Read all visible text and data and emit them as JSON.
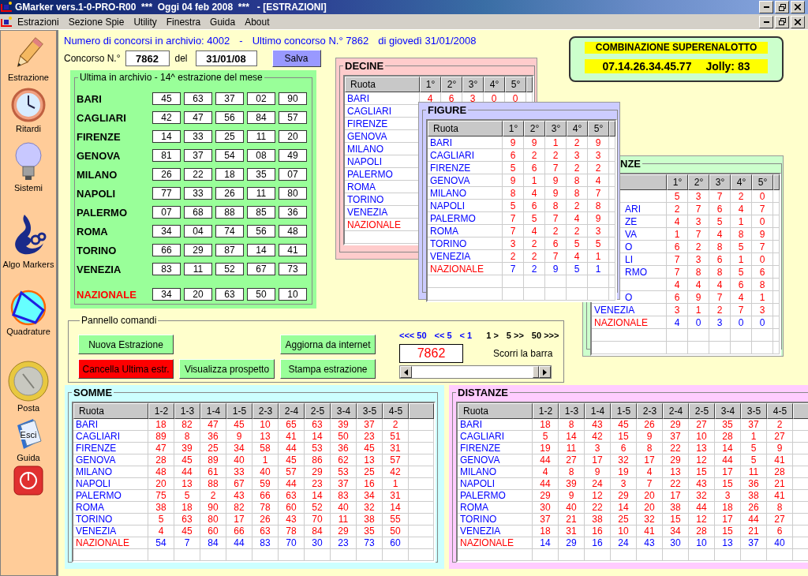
{
  "window": {
    "title": "GMarker vers.1-0-PRO-R00  ***  Oggi 04 feb 2008  ***   - [ESTRAZIONI]"
  },
  "menu": [
    "Estrazioni",
    "Sezione Spie",
    "Utility",
    "Finestra",
    "Guida",
    "About"
  ],
  "sidebar": [
    {
      "kind": "pencil",
      "label": "Estrazione"
    },
    {
      "kind": "clock",
      "label": "Ritardi"
    },
    {
      "kind": "bulb",
      "label": "Sistemi"
    },
    {
      "kind": "logo",
      "label": "Algo Markers"
    },
    {
      "kind": "shape",
      "label": "Quadrature"
    },
    {
      "kind": "coin",
      "label": "Posta"
    },
    {
      "kind": "book",
      "label": "Guida",
      "overlay": "Esci"
    },
    {
      "kind": "power"
    }
  ],
  "header": {
    "archive": "Numero di concorsi in archivio: 4002",
    "separator": "-",
    "last": "Ultimo concorso N.° 7862",
    "date": "di giovedì 31/01/2008"
  },
  "concorso": {
    "label": "Concorso N.°",
    "number": "7862",
    "del": "del",
    "date": "31/01/08",
    "save": "Salva"
  },
  "ultima": {
    "title": "Ultima in archivio - 14^ estrazione del mese",
    "rows": [
      {
        "name": "BARI",
        "kind": "ruota",
        "numbers": [
          "45",
          "63",
          "37",
          "02",
          "90"
        ]
      },
      {
        "name": "CAGLIARI",
        "kind": "ruota",
        "numbers": [
          "42",
          "47",
          "56",
          "84",
          "57"
        ]
      },
      {
        "name": "FIRENZE",
        "kind": "ruota",
        "numbers": [
          "14",
          "33",
          "25",
          "11",
          "20"
        ]
      },
      {
        "name": "GENOVA",
        "kind": "ruota",
        "numbers": [
          "81",
          "37",
          "54",
          "08",
          "49"
        ]
      },
      {
        "name": "MILANO",
        "kind": "ruota",
        "numbers": [
          "26",
          "22",
          "18",
          "35",
          "07"
        ]
      },
      {
        "name": "NAPOLI",
        "kind": "ruota",
        "numbers": [
          "77",
          "33",
          "26",
          "11",
          "80"
        ]
      },
      {
        "name": "PALERMO",
        "kind": "ruota",
        "numbers": [
          "07",
          "68",
          "88",
          "85",
          "36"
        ]
      },
      {
        "name": "ROMA",
        "kind": "ruota",
        "numbers": [
          "34",
          "04",
          "74",
          "56",
          "48"
        ]
      },
      {
        "name": "TORINO",
        "kind": "ruota",
        "numbers": [
          "66",
          "29",
          "87",
          "14",
          "41"
        ]
      },
      {
        "name": "VENEZIA",
        "kind": "ruota",
        "numbers": [
          "83",
          "11",
          "52",
          "67",
          "73"
        ]
      },
      {
        "name": "NAZIONALE",
        "kind": "nazionale",
        "numbers": [
          "34",
          "20",
          "63",
          "50",
          "10"
        ]
      }
    ]
  },
  "superenalotto": {
    "title": "COMBINAZIONE SUPERENALOTTO",
    "combination": "07.14.26.34.45.77",
    "jolly": "Jolly: 83"
  },
  "decine": {
    "title": "DECINE",
    "columns": [
      "Ruota",
      "1°",
      "2°",
      "3°",
      "4°",
      "5°"
    ],
    "rows": [
      {
        "name": "BARI",
        "kind": "ruota",
        "values": [
          "4",
          "6",
          "3",
          "0",
          "0"
        ]
      },
      {
        "name": "CAGLIARI",
        "kind": "ruota"
      },
      {
        "name": "FIRENZE",
        "kind": "ruota"
      },
      {
        "name": "GENOVA",
        "kind": "ruota"
      },
      {
        "name": "MILANO",
        "kind": "ruota"
      },
      {
        "name": "NAPOLI",
        "kind": "ruota"
      },
      {
        "name": "PALERMO",
        "kind": "ruota"
      },
      {
        "name": "ROMA",
        "kind": "ruota"
      },
      {
        "name": "TORINO",
        "kind": "ruota"
      },
      {
        "name": "VENEZIA",
        "kind": "ruota"
      },
      {
        "name": "NAZIONALE",
        "kind": "nazionale"
      }
    ]
  },
  "figure": {
    "title": "FIGURE",
    "columns": [
      "Ruota",
      "1°",
      "2°",
      "3°",
      "4°",
      "5°"
    ],
    "rows": [
      {
        "name": "BARI",
        "kind": "ruota",
        "values": [
          "9",
          "9",
          "1",
          "2",
          "9"
        ]
      },
      {
        "name": "CAGLIARI",
        "kind": "ruota",
        "values": [
          "6",
          "2",
          "2",
          "3",
          "3"
        ]
      },
      {
        "name": "FIRENZE",
        "kind": "ruota",
        "values": [
          "5",
          "6",
          "7",
          "2",
          "2"
        ]
      },
      {
        "name": "GENOVA",
        "kind": "ruota",
        "values": [
          "9",
          "1",
          "9",
          "8",
          "4"
        ]
      },
      {
        "name": "MILANO",
        "kind": "ruota",
        "values": [
          "8",
          "4",
          "9",
          "8",
          "7"
        ]
      },
      {
        "name": "NAPOLI",
        "kind": "ruota",
        "values": [
          "5",
          "6",
          "8",
          "2",
          "8"
        ]
      },
      {
        "name": "PALERMO",
        "kind": "ruota",
        "values": [
          "7",
          "5",
          "7",
          "4",
          "9"
        ]
      },
      {
        "name": "ROMA",
        "kind": "ruota",
        "values": [
          "7",
          "4",
          "2",
          "2",
          "3"
        ]
      },
      {
        "name": "TORINO",
        "kind": "ruota",
        "values": [
          "3",
          "2",
          "6",
          "5",
          "5"
        ]
      },
      {
        "name": "VENEZIA",
        "kind": "ruota",
        "values": [
          "2",
          "2",
          "7",
          "4",
          "1"
        ]
      },
      {
        "name": "NAZIONALE",
        "kind": "nazionale",
        "values": [
          "7",
          "2",
          "9",
          "5",
          "1"
        ]
      }
    ]
  },
  "panel_3": {
    "title": "NZE",
    "columns": [
      "1°",
      "2°",
      "3°",
      "4°",
      "5°"
    ],
    "rows": [
      {
        "kind": "ruota",
        "values": [
          "5",
          "3",
          "7",
          "2",
          "0"
        ]
      },
      {
        "name": "ARI",
        "kind": "ruota",
        "partial": true,
        "values": [
          "2",
          "7",
          "6",
          "4",
          "7"
        ]
      },
      {
        "name": "ZE",
        "kind": "ruota",
        "partial": true,
        "values": [
          "4",
          "3",
          "5",
          "1",
          "0"
        ]
      },
      {
        "name": "VA",
        "kind": "ruota",
        "partial": true,
        "values": [
          "1",
          "7",
          "4",
          "8",
          "9"
        ]
      },
      {
        "name": "O",
        "kind": "ruota",
        "partial": true,
        "values": [
          "6",
          "2",
          "8",
          "5",
          "7"
        ]
      },
      {
        "name": "LI",
        "kind": "ruota",
        "partial": true,
        "values": [
          "7",
          "3",
          "6",
          "1",
          "0"
        ]
      },
      {
        "name": "RMO",
        "kind": "ruota",
        "partial": true,
        "values": [
          "7",
          "8",
          "8",
          "5",
          "6"
        ]
      },
      {
        "kind": "ruota",
        "values": [
          "4",
          "4",
          "4",
          "6",
          "8"
        ]
      },
      {
        "name": "O",
        "kind": "ruota",
        "partial": true,
        "values": [
          "6",
          "9",
          "7",
          "4",
          "1"
        ]
      },
      {
        "name": "VENEZIA",
        "kind": "ruota",
        "partial": false,
        "values": [
          "3",
          "1",
          "2",
          "7",
          "3"
        ]
      },
      {
        "name": "NAZIONALE",
        "kind": "nazionale",
        "partial": false,
        "values": [
          "4",
          "0",
          "3",
          "0",
          "0"
        ]
      }
    ]
  },
  "commands": {
    "title": "Pannello comandi",
    "buttons": [
      {
        "label": "Nuova Estrazione",
        "kind": "normal"
      },
      {
        "label": "Aggiorna da internet",
        "kind": "normal"
      },
      {
        "label": "Cancella Ultima estr.",
        "kind": "danger"
      },
      {
        "label": "Visualizza prospetto",
        "kind": "normal"
      },
      {
        "label": "Stampa estrazione",
        "kind": "normal"
      }
    ],
    "nav": [
      {
        "label": "<<< 50",
        "kind": "back"
      },
      {
        "label": "<< 5",
        "kind": "back"
      },
      {
        "label": "< 1",
        "kind": "back"
      },
      {
        "label": "1 >",
        "kind": "forward"
      },
      {
        "label": "5 >>",
        "kind": "forward"
      },
      {
        "label": "50 >>>",
        "kind": "forward"
      }
    ],
    "counter": "7862",
    "scroll_label": "Scorri la barra"
  },
  "somme": {
    "title": "SOMME",
    "columns": [
      "Ruota",
      "1-2",
      "1-3",
      "1-4",
      "1-5",
      "2-3",
      "2-4",
      "2-5",
      "3-4",
      "3-5",
      "4-5"
    ],
    "rows": [
      {
        "name": "BARI",
        "kind": "ruota",
        "values": [
          "18",
          "82",
          "47",
          "45",
          "10",
          "65",
          "63",
          "39",
          "37",
          "2"
        ]
      },
      {
        "name": "CAGLIARI",
        "kind": "ruota",
        "values": [
          "89",
          "8",
          "36",
          "9",
          "13",
          "41",
          "14",
          "50",
          "23",
          "51"
        ]
      },
      {
        "name": "FIRENZE",
        "kind": "ruota",
        "values": [
          "47",
          "39",
          "25",
          "34",
          "58",
          "44",
          "53",
          "36",
          "45",
          "31"
        ]
      },
      {
        "name": "GENOVA",
        "kind": "ruota",
        "values": [
          "28",
          "45",
          "89",
          "40",
          "1",
          "45",
          "86",
          "62",
          "13",
          "57"
        ]
      },
      {
        "name": "MILANO",
        "kind": "ruota",
        "values": [
          "48",
          "44",
          "61",
          "33",
          "40",
          "57",
          "29",
          "53",
          "25",
          "42"
        ]
      },
      {
        "name": "NAPOLI",
        "kind": "ruota",
        "values": [
          "20",
          "13",
          "88",
          "67",
          "59",
          "44",
          "23",
          "37",
          "16",
          "1"
        ]
      },
      {
        "name": "PALERMO",
        "kind": "ruota",
        "values": [
          "75",
          "5",
          "2",
          "43",
          "66",
          "63",
          "14",
          "83",
          "34",
          "31"
        ]
      },
      {
        "name": "ROMA",
        "kind": "ruota",
        "values": [
          "38",
          "18",
          "90",
          "82",
          "78",
          "60",
          "52",
          "40",
          "32",
          "14"
        ]
      },
      {
        "name": "TORINO",
        "kind": "ruota",
        "values": [
          "5",
          "63",
          "80",
          "17",
          "26",
          "43",
          "70",
          "11",
          "38",
          "55"
        ]
      },
      {
        "name": "VENEZIA",
        "kind": "ruota",
        "values": [
          "4",
          "45",
          "60",
          "66",
          "63",
          "78",
          "84",
          "29",
          "35",
          "50"
        ]
      },
      {
        "name": "NAZIONALE",
        "kind": "nazionale",
        "values": [
          "54",
          "7",
          "84",
          "44",
          "83",
          "70",
          "30",
          "23",
          "73",
          "60"
        ]
      }
    ]
  },
  "distanze": {
    "title": "DISTANZE",
    "columns": [
      "Ruota",
      "1-2",
      "1-3",
      "1-4",
      "1-5",
      "2-3",
      "2-4",
      "2-5",
      "3-4",
      "3-5",
      "4-5"
    ],
    "rows": [
      {
        "name": "BARI",
        "kind": "ruota",
        "values": [
          "18",
          "8",
          "43",
          "45",
          "26",
          "29",
          "27",
          "35",
          "37",
          "2"
        ]
      },
      {
        "name": "CAGLIARI",
        "kind": "ruota",
        "values": [
          "5",
          "14",
          "42",
          "15",
          "9",
          "37",
          "10",
          "28",
          "1",
          "27"
        ]
      },
      {
        "name": "FIRENZE",
        "kind": "ruota",
        "values": [
          "19",
          "11",
          "3",
          "6",
          "8",
          "22",
          "13",
          "14",
          "5",
          "9"
        ]
      },
      {
        "name": "GENOVA",
        "kind": "ruota",
        "values": [
          "44",
          "27",
          "17",
          "32",
          "17",
          "29",
          "12",
          "44",
          "5",
          "41"
        ]
      },
      {
        "name": "MILANO",
        "kind": "ruota",
        "values": [
          "4",
          "8",
          "9",
          "19",
          "4",
          "13",
          "15",
          "17",
          "11",
          "28"
        ]
      },
      {
        "name": "NAPOLI",
        "kind": "ruota",
        "values": [
          "44",
          "39",
          "24",
          "3",
          "7",
          "22",
          "43",
          "15",
          "36",
          "21"
        ]
      },
      {
        "name": "PALERMO",
        "kind": "ruota",
        "values": [
          "29",
          "9",
          "12",
          "29",
          "20",
          "17",
          "32",
          "3",
          "38",
          "41"
        ]
      },
      {
        "name": "ROMA",
        "kind": "ruota",
        "values": [
          "30",
          "40",
          "22",
          "14",
          "20",
          "38",
          "44",
          "18",
          "26",
          "8"
        ]
      },
      {
        "name": "TORINO",
        "kind": "ruota",
        "values": [
          "37",
          "21",
          "38",
          "25",
          "32",
          "15",
          "12",
          "17",
          "44",
          "27"
        ]
      },
      {
        "name": "VENEZIA",
        "kind": "ruota",
        "values": [
          "18",
          "31",
          "16",
          "10",
          "41",
          "34",
          "28",
          "15",
          "21",
          "6"
        ]
      },
      {
        "name": "NAZIONALE",
        "kind": "nazionale",
        "values": [
          "14",
          "29",
          "16",
          "24",
          "43",
          "30",
          "10",
          "13",
          "37",
          "40"
        ]
      }
    ]
  }
}
